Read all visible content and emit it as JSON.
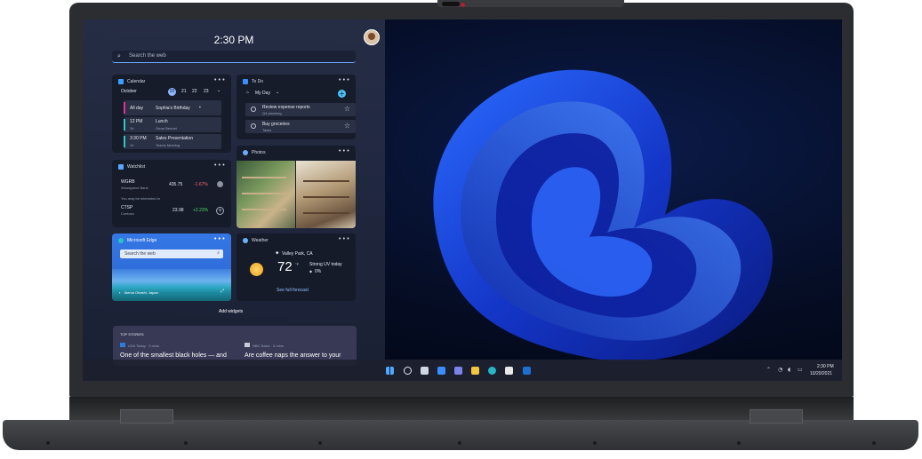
{
  "panel": {
    "time": "2:30 PM",
    "search_placeholder": "Search the web",
    "add_widgets": "Add widgets"
  },
  "calendar": {
    "title": "Calendar",
    "month": "October",
    "days": [
      "20",
      "21",
      "22",
      "23"
    ],
    "events": [
      {
        "time": "All day",
        "duration": "",
        "title": "Sophia's Birthday",
        "sub": "",
        "color": "#e0309a"
      },
      {
        "time": "12 PM",
        "duration": "1h",
        "title": "Lunch",
        "sub": "Omar Bennet",
        "color": "#32c5c0"
      },
      {
        "time": "3:30 PM",
        "duration": "1h",
        "title": "Sales Presentation",
        "sub": "Teams Meeting",
        "color": "#32c5c0"
      }
    ]
  },
  "todo": {
    "title": "To Do",
    "list": "My Day",
    "items": [
      {
        "title": "Review expense reports",
        "sub": "Q4 planning"
      },
      {
        "title": "Buy groceries",
        "sub": "Tasks"
      }
    ]
  },
  "watchlist": {
    "title": "Watchlist",
    "note": "You may be interested in",
    "stocks": [
      {
        "symbol": "WGRB",
        "name": "Woodgrove Bank",
        "price": "435.75",
        "change": "-1.67%",
        "color": "#ff6b6b"
      },
      {
        "symbol": "CTSP",
        "name": "Contoso",
        "price": "23.98",
        "change": "+2.23%",
        "color": "#4cd964"
      }
    ]
  },
  "photos": {
    "title": "Photos"
  },
  "edge": {
    "title": "Microsoft Edge",
    "search_placeholder": "Search the web",
    "caption": "Ikema Ohashi, Japan"
  },
  "weather": {
    "title": "Weather",
    "location": "Valley Park, CA",
    "temp": "72",
    "unit": "°F",
    "condition": "Strong UV today",
    "precip": "0%",
    "link": "See full forecast"
  },
  "news": {
    "heading": "TOP STORIES",
    "stories": [
      {
        "source": "USA Today · 3 mins",
        "headline": "One of the smallest black holes — and"
      },
      {
        "source": "NBC News · 5 mins",
        "headline": "Are coffee naps the answer to your"
      }
    ]
  },
  "taskbar": {
    "clock_time": "2:30 PM",
    "clock_date": "10/20/2021"
  },
  "colors": {
    "accent": "#6fa8ff",
    "edge_blue": "#2f7bd9",
    "wallpaper_bloom": "#1540d6"
  }
}
